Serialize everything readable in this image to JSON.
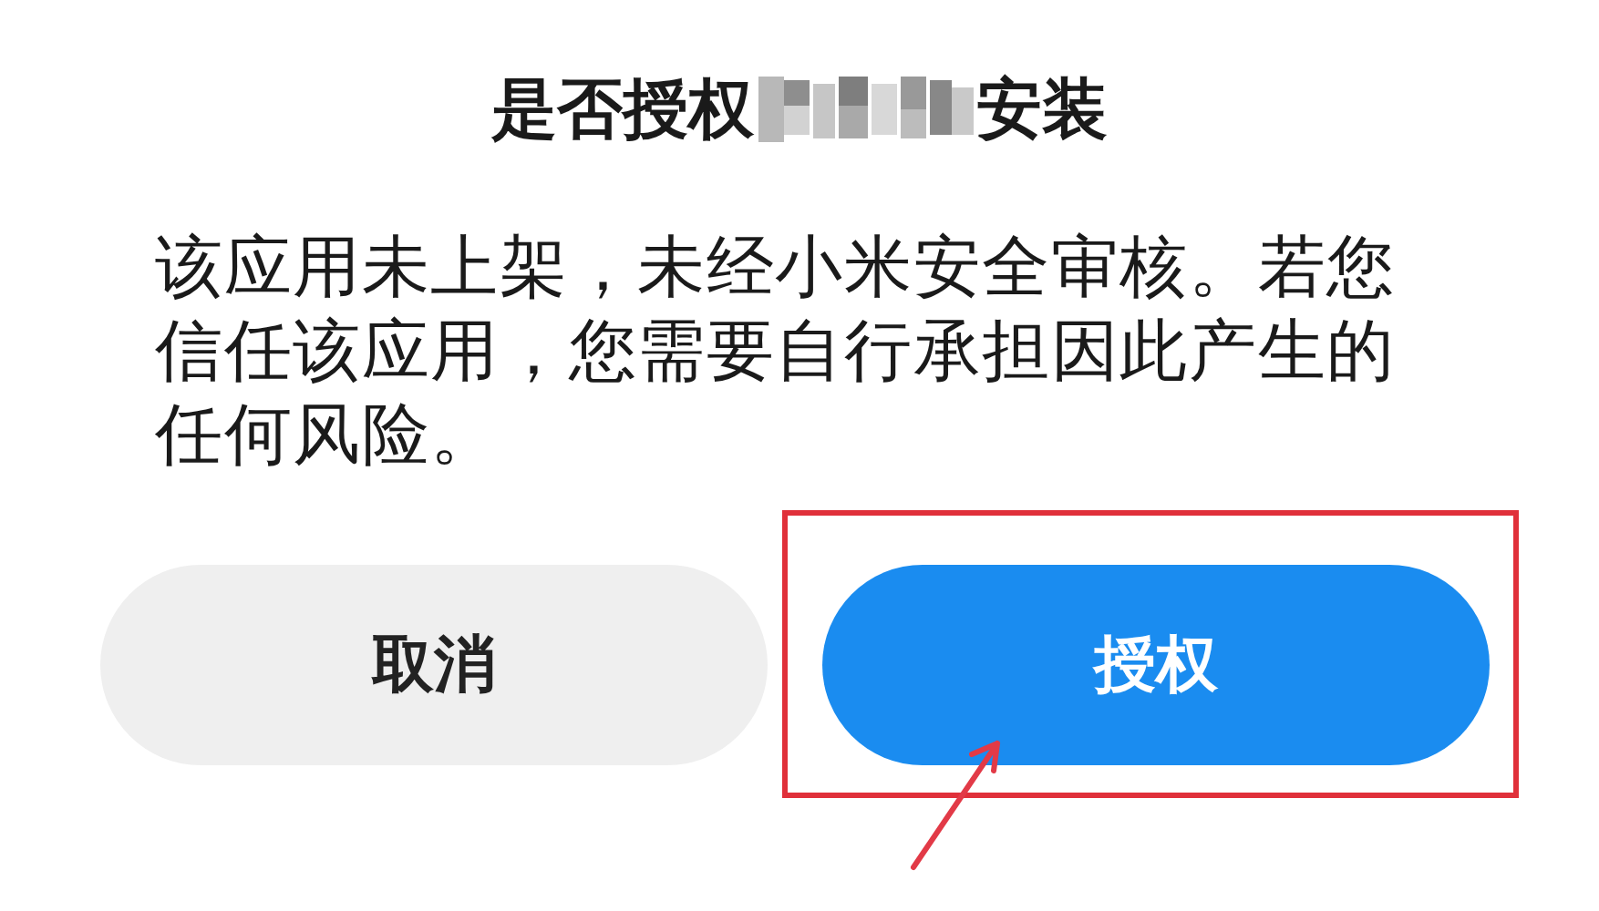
{
  "dialog": {
    "title_start": "是否授权",
    "title_end": "安装",
    "message": "该应用未上架，未经小米安全审核。若您信任该应用，您需要自行承担因此产生的任何风险。",
    "buttons": [
      {
        "label": "取消",
        "kind": "secondary",
        "highlighted": false
      },
      {
        "label": "授权",
        "kind": "primary",
        "highlighted": true
      }
    ]
  }
}
